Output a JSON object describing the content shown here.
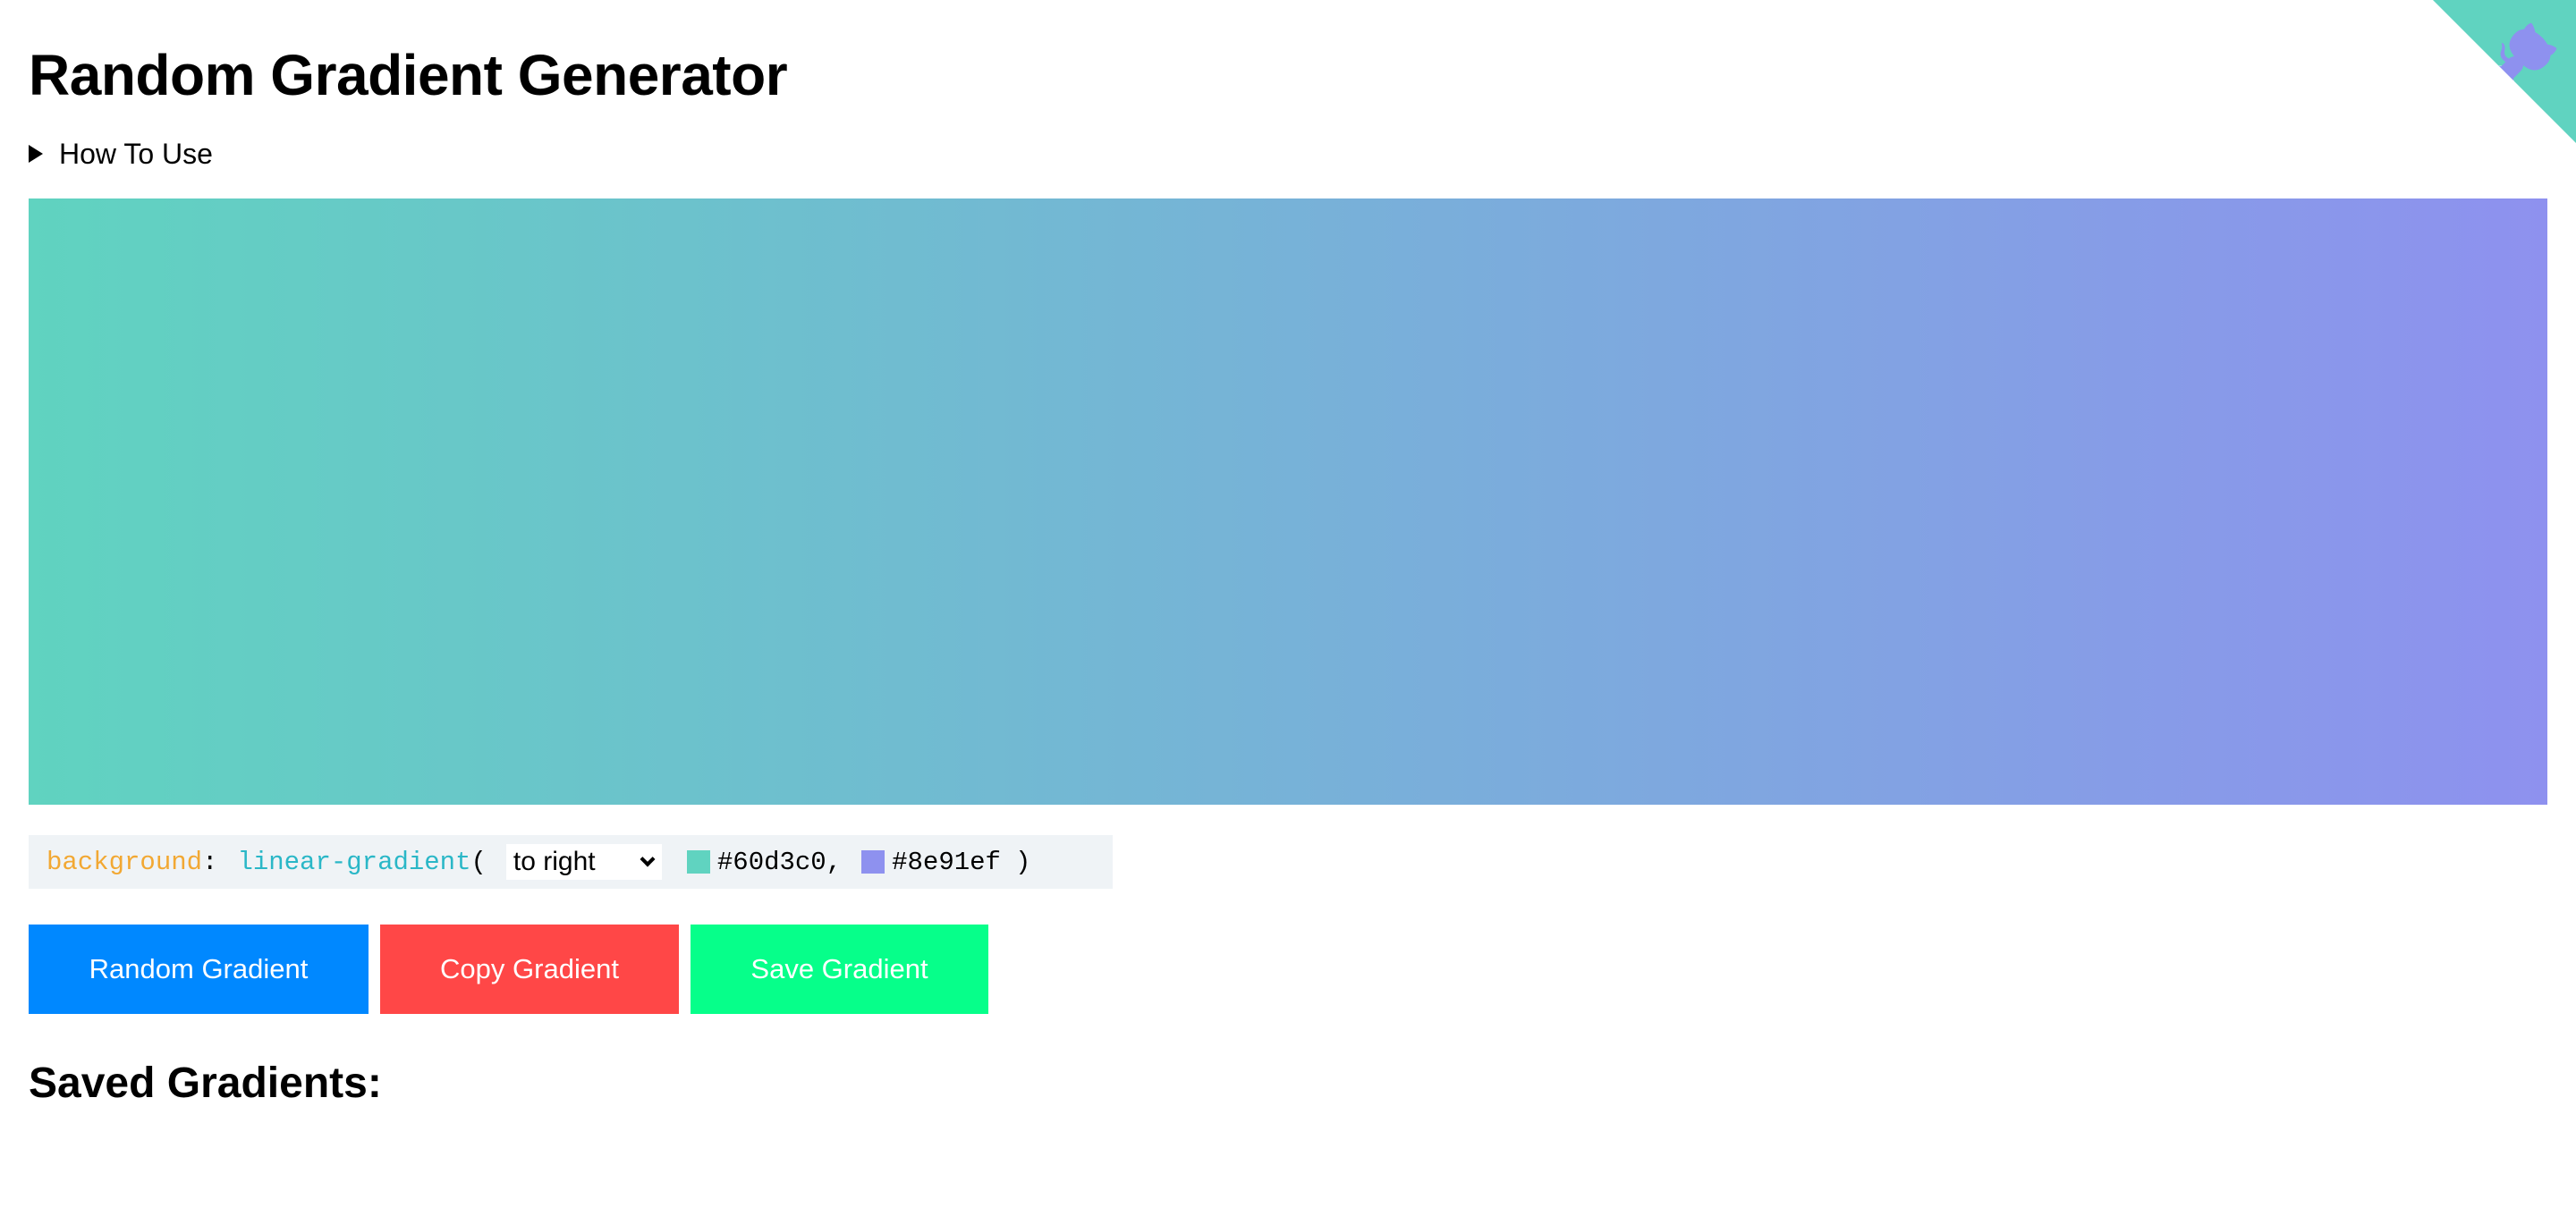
{
  "page": {
    "title": "Random Gradient Generator",
    "how_to_use_label": "How To Use",
    "saved_heading": "Saved Gradients:"
  },
  "gradient": {
    "direction": "to right",
    "color1": "#60d3c0",
    "color2": "#8e91ef"
  },
  "code": {
    "property": "background",
    "colon": ":",
    "function": "linear-gradient",
    "open_paren": "(",
    "close_paren": ")",
    "color1_text": "#60d3c0,",
    "color2_text": "#8e91ef"
  },
  "buttons": {
    "random_label": "Random Gradient",
    "random_color": "#0088ff",
    "copy_label": "Copy Gradient",
    "copy_color": "#ff4747",
    "save_label": "Save Gradient",
    "save_color": "#06ff8a"
  },
  "corner": {
    "icon": "github-octocat-icon",
    "background_color": "#60d3c0",
    "icon_color": "#8e91ef"
  }
}
